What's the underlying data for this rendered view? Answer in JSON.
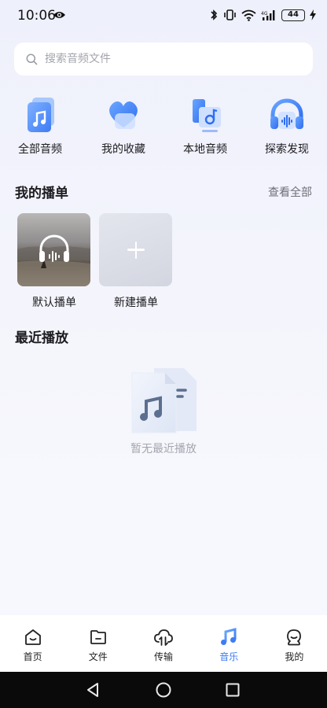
{
  "status_bar": {
    "time": "10:06",
    "battery": "44"
  },
  "search": {
    "placeholder": "搜索音频文件"
  },
  "categories": [
    {
      "label": "全部音频",
      "icon": "all-audio-icon"
    },
    {
      "label": "我的收藏",
      "icon": "favorites-heart-icon"
    },
    {
      "label": "本地音频",
      "icon": "local-audio-icon"
    },
    {
      "label": "探索发现",
      "icon": "explore-headphones-icon"
    }
  ],
  "playlists_section": {
    "title": "我的播单",
    "view_all": "查看全部",
    "items": [
      {
        "label": "默认播单",
        "icon": "headphones-icon"
      },
      {
        "label": "新建播单",
        "icon": "plus-icon"
      }
    ]
  },
  "recent_section": {
    "title": "最近播放",
    "empty_text": "暂无最近播放"
  },
  "bottom_nav": {
    "active_color": "#3d7cf5",
    "items": [
      {
        "label": "首页",
        "icon": "home-icon"
      },
      {
        "label": "文件",
        "icon": "folder-icon"
      },
      {
        "label": "传输",
        "icon": "cloud-transfer-icon"
      },
      {
        "label": "音乐",
        "icon": "music-note-icon",
        "active": true
      },
      {
        "label": "我的",
        "icon": "profile-icon"
      }
    ]
  }
}
